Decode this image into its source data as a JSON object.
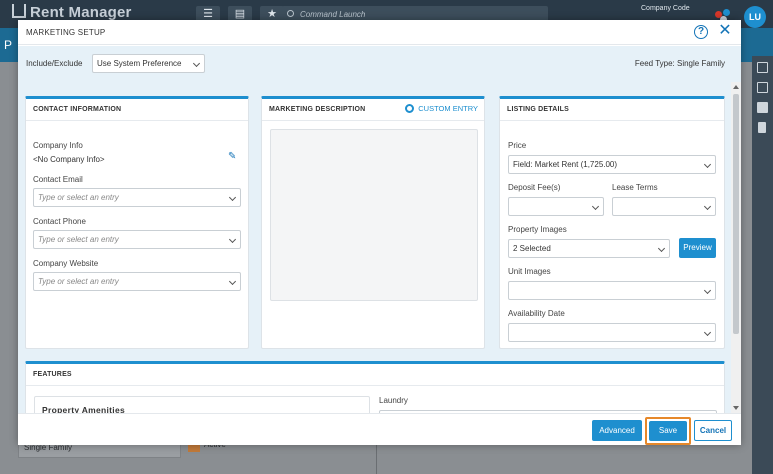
{
  "app": {
    "logo_text": "Rent Manager",
    "search_placeholder": "Command Launch",
    "company_label": "Company Code",
    "avatar_initials": "LU",
    "subbar_letter": "P",
    "background_select_value": "Single Family",
    "background_active_label": "Active",
    "nav_icons": [
      "menu-icon",
      "document-icon",
      "star-icon"
    ]
  },
  "modal": {
    "title": "MARKETING SETUP",
    "help_glyph": "?",
    "close_glyph": "✕",
    "filter": {
      "label": "Include/Exclude",
      "value": "Use System Preference",
      "feed_type": "Feed Type: Single Family"
    },
    "contact": {
      "title": "CONTACT INFORMATION",
      "company_info_label": "Company Info",
      "company_info_value": "<No Company Info>",
      "email_label": "Contact Email",
      "email_placeholder": "Type or select an entry",
      "phone_label": "Contact Phone",
      "phone_placeholder": "Type or select an entry",
      "website_label": "Company Website",
      "website_placeholder": "Type or select an entry"
    },
    "marketing": {
      "title": "MARKETING DESCRIPTION",
      "custom_entry_label": "CUSTOM ENTRY"
    },
    "listing": {
      "title": "LISTING DETAILS",
      "price_label": "Price",
      "price_value": "Field: Market Rent (1,725.00)",
      "deposit_label": "Deposit Fee(s)",
      "lease_terms_label": "Lease Terms",
      "property_images_label": "Property Images",
      "property_images_value": "2 Selected",
      "preview_label": "Preview",
      "unit_images_label": "Unit Images",
      "availability_label": "Availability Date"
    },
    "features": {
      "title": "FEATURES",
      "amenities_title": "Property Amenities",
      "laundry_label": "Laundry"
    },
    "footer": {
      "advanced_label": "Advanced",
      "save_label": "Save",
      "cancel_label": "Cancel"
    }
  },
  "colors": {
    "accent": "#1e8fcf",
    "highlight": "#e6882a",
    "panel_bg": "#e6f1f8"
  }
}
